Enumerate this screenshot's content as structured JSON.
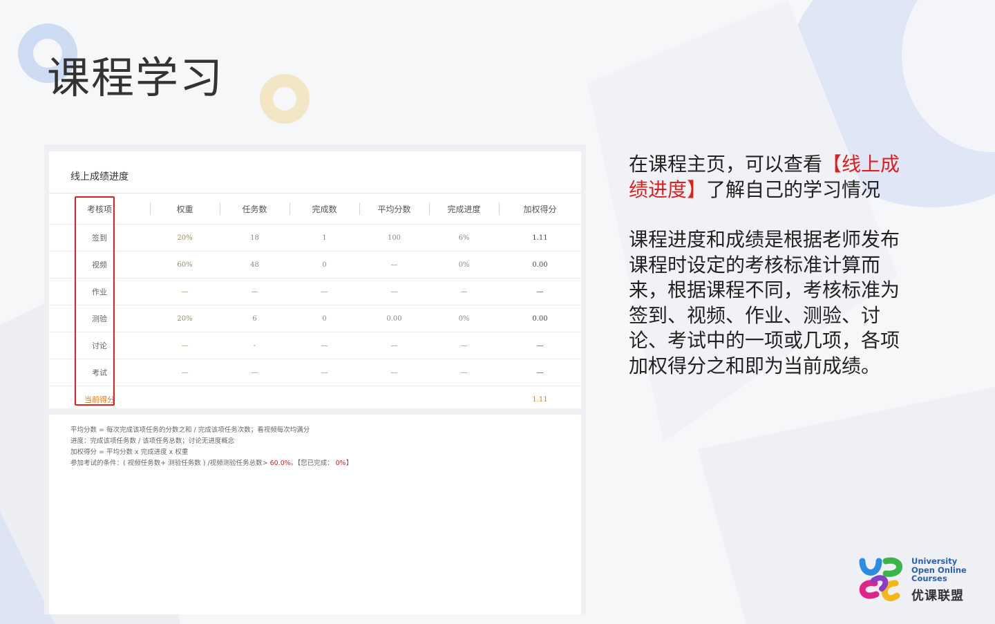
{
  "slide": {
    "title": "课程学习"
  },
  "card": {
    "title": "线上成绩进度",
    "columns": [
      "考核项",
      "权重",
      "任务数",
      "完成数",
      "平均分数",
      "完成进度",
      "加权得分"
    ],
    "rows": [
      [
        "签到",
        "20%",
        "18",
        "1",
        "100",
        "6%",
        "1.11"
      ],
      [
        "视频",
        "60%",
        "48",
        "0",
        "—",
        "0%",
        "0.00"
      ],
      [
        "作业",
        "—",
        "—",
        "—",
        "—",
        "—",
        "—"
      ],
      [
        "测验",
        "20%",
        "6",
        "0",
        "0.00",
        "0%",
        "0.00"
      ],
      [
        "讨论",
        "—",
        "-",
        "—",
        "—",
        "—",
        "—"
      ],
      [
        "考试",
        "—",
        "—",
        "—",
        "—",
        "—",
        "—"
      ]
    ],
    "total": {
      "label": "当前得分",
      "value": "1.11"
    }
  },
  "notes": {
    "line1": "平均分数 = 每次完成该项任务的分数之和 / 完成该项任务次数；看视频每次均满分",
    "line2": "进度：完成该项任务数 / 该项任务总数；讨论无进度概念",
    "line3": "加权得分 = 平均分数 x 完成进度 x 权重",
    "line4_prefix": "参加考试的条件：( 视频任务数+ 测验任务数 ) /视频测验任务总数> ",
    "line4_threshold": "60.0%",
    "line4_mid": "。【您已完成： ",
    "line4_done": "0%",
    "line4_suffix": "】"
  },
  "explain": {
    "p1_before": "在课程主页，可以查看",
    "p1_highlight": "【线上成绩进度】",
    "p1_after": "了解自己的学习情况",
    "p2": "课程进度和成绩是根据老师发布课程时设定的考核标准计算而来，根据课程不同，考核标准为签到、视频、作业、测验、讨论、考试中的一项或几项，各项加权得分之和即为当前成绩。"
  },
  "logo": {
    "line1": "University",
    "line2": "Open Online",
    "line3": "Courses",
    "cn": "优课联盟"
  },
  "colors": {
    "highlight": "#e01e1e",
    "total": "#e07a18",
    "box": "#e02020",
    "logo_blue": "#2d5fb0"
  }
}
